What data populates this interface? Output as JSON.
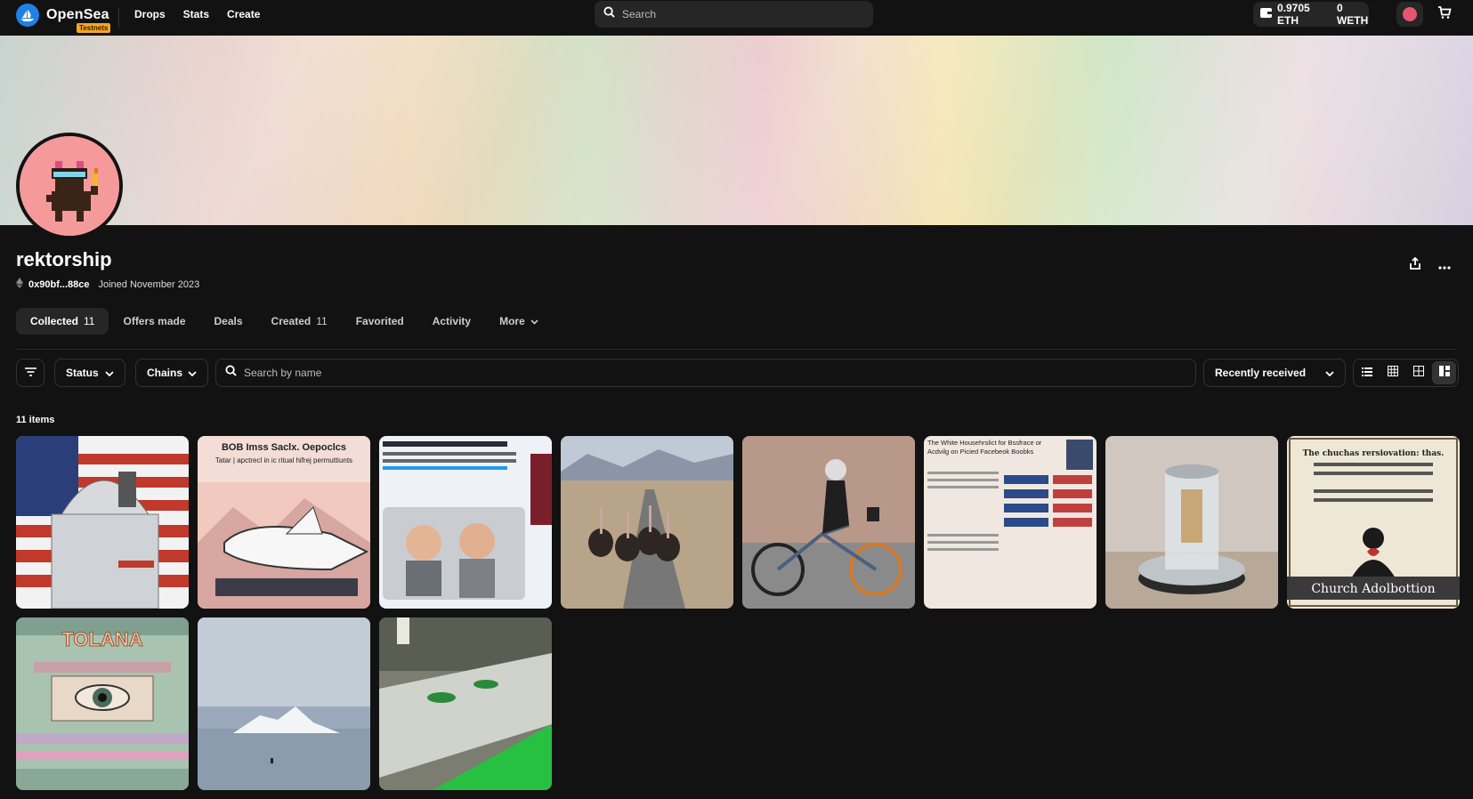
{
  "nav": {
    "logo_text": "OpenSea",
    "testnets_badge": "Testnets",
    "links": [
      "Drops",
      "Stats",
      "Create"
    ],
    "search_placeholder": "Search",
    "balance_eth": "0.9705 ETH",
    "balance_weth": "0 WETH"
  },
  "profile": {
    "username": "rektorship",
    "address": "0x90bf...88ce",
    "joined": "Joined November 2023"
  },
  "tabs": [
    {
      "label": "Collected",
      "count": "11"
    },
    {
      "label": "Offers made",
      "count": ""
    },
    {
      "label": "Deals",
      "count": ""
    },
    {
      "label": "Created",
      "count": "11"
    },
    {
      "label": "Favorited",
      "count": ""
    },
    {
      "label": "Activity",
      "count": ""
    },
    {
      "label": "More",
      "count": ""
    }
  ],
  "filters": {
    "status_label": "Status",
    "chains_label": "Chains",
    "search_placeholder": "Search by name",
    "sort_label": "Recently received"
  },
  "items_count": "11 items",
  "items": [
    {
      "title": "",
      "text": ""
    },
    {
      "title": "BOB Imss Saclx. Oepoclcs",
      "text": "Tatar | apctrecl in ic ritual hifrej permuttiunts"
    },
    {
      "title": "",
      "text": ""
    },
    {
      "title": "",
      "text": ""
    },
    {
      "title": "",
      "text": ""
    },
    {
      "title": "The White Househrslict for Bssfrace or",
      "text": "Acdvilg on Picied Facebeok Boobks"
    },
    {
      "title": "",
      "text": ""
    },
    {
      "title": "The chuchas rersiovation: thas.",
      "text": "Church Adolbottion"
    },
    {
      "title": "TOLANA",
      "text": ""
    },
    {
      "title": "",
      "text": ""
    },
    {
      "title": "",
      "text": ""
    }
  ],
  "colors": {
    "background": "#121212",
    "surface": "#262626",
    "accent": "#2081e2",
    "testnets": "#f5a623"
  },
  "icons": [
    "opensea-logo-icon",
    "search-icon",
    "wallet-icon",
    "cart-icon",
    "eth-icon",
    "share-icon",
    "more-icon",
    "filter-icon",
    "chevron-down-icon",
    "list-view-icon",
    "grid-small-icon",
    "grid-medium-icon",
    "grid-large-icon"
  ]
}
